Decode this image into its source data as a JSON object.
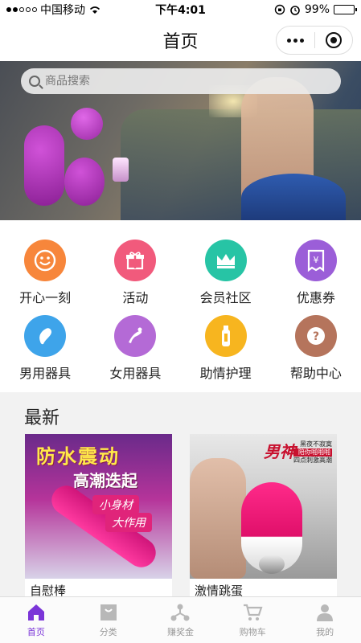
{
  "status_bar": {
    "carrier": "中国移动",
    "time": "下午4:01",
    "battery": "99%",
    "battery_level": 0.99
  },
  "nav": {
    "title": "首页"
  },
  "search": {
    "placeholder": "商品搜索"
  },
  "categories": [
    {
      "label": "开心一刻",
      "color": "#f7863b",
      "icon": "smile-icon"
    },
    {
      "label": "活动",
      "color": "#f15a7c",
      "icon": "gift-icon"
    },
    {
      "label": "会员社区",
      "color": "#27c4a5",
      "icon": "crown-icon"
    },
    {
      "label": "优惠券",
      "color": "#9b5ed8",
      "icon": "coupon-icon"
    },
    {
      "label": "男用器具",
      "color": "#3ea4ea",
      "icon": "male-toy-icon"
    },
    {
      "label": "女用器具",
      "color": "#b46ad6",
      "icon": "female-toy-icon"
    },
    {
      "label": "助情护理",
      "color": "#f7b51f",
      "icon": "bottle-icon"
    },
    {
      "label": "帮助中心",
      "color": "#b5745c",
      "icon": "help-icon"
    }
  ],
  "newest": {
    "title": "最新",
    "products": [
      {
        "name": "自慰棒",
        "promo_title": "防水震动",
        "promo_sub": "高潮迭起",
        "promo_tag1": "小身材",
        "promo_tag2": "大作用"
      },
      {
        "name": "激情跳蛋",
        "promo_title": "男神",
        "promo_line1": "黑夜不寂寞",
        "promo_line2": "陪你啪啪啪",
        "promo_line3": "四点刺激高潮"
      }
    ]
  },
  "tabs": [
    {
      "label": "首页",
      "icon": "home-icon",
      "active": true
    },
    {
      "label": "分类",
      "icon": "bag-icon",
      "active": false
    },
    {
      "label": "赚奖金",
      "icon": "share-icon",
      "active": false
    },
    {
      "label": "购物车",
      "icon": "cart-icon",
      "active": false
    },
    {
      "label": "我的",
      "icon": "user-icon",
      "active": false
    }
  ],
  "colors": {
    "accent": "#7b35d8",
    "tab_inactive": "#b8b8b8"
  }
}
